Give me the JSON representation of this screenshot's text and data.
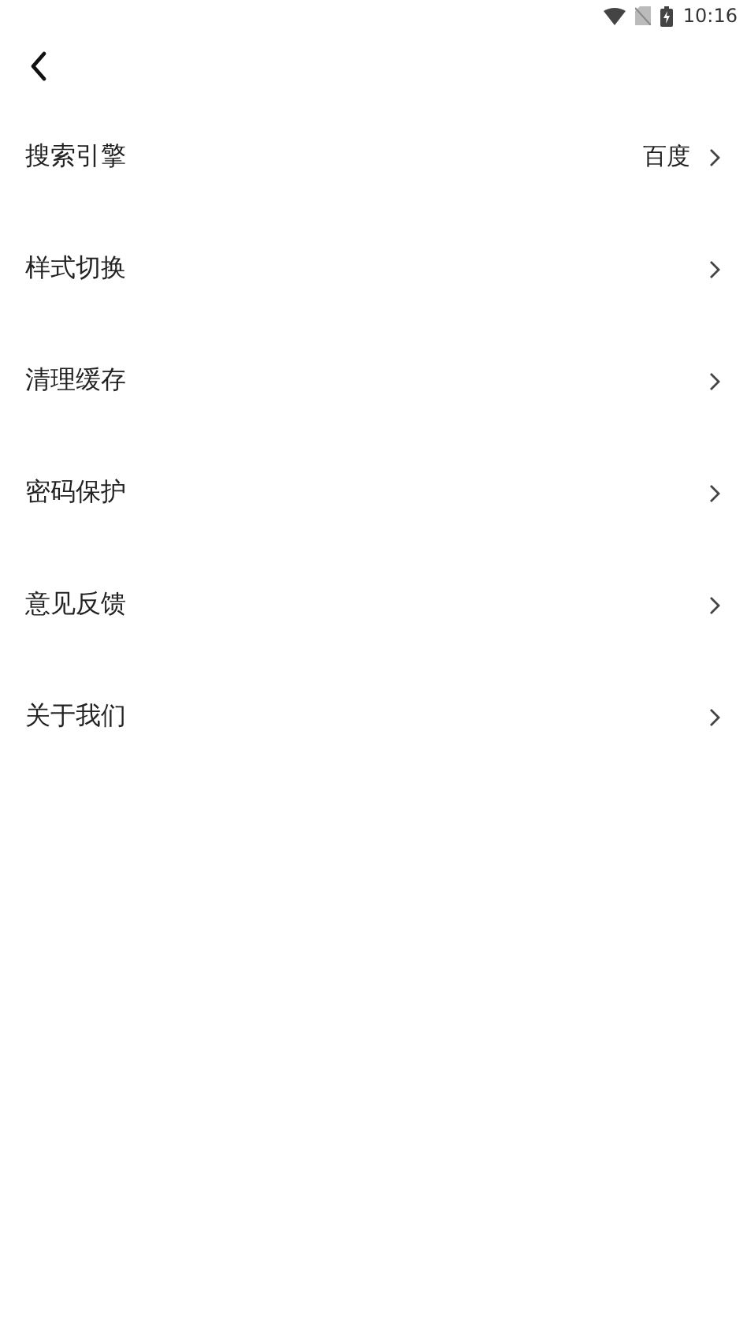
{
  "status_bar": {
    "time": "10:16"
  },
  "settings": [
    {
      "label": "搜索引擎",
      "value": "百度"
    },
    {
      "label": "样式切换"
    },
    {
      "label": "清理缓存"
    },
    {
      "label": "密码保护"
    },
    {
      "label": "意见反馈"
    },
    {
      "label": "关于我们"
    }
  ]
}
